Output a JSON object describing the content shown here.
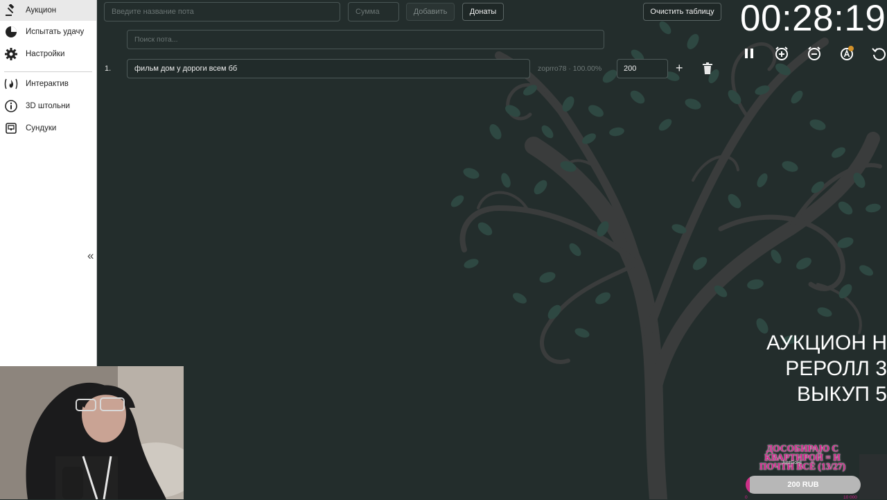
{
  "sidebar": {
    "items": [
      {
        "label": "Аукцион",
        "icon": "gavel-icon"
      },
      {
        "label": "Испытать удачу",
        "icon": "pie-chart-icon"
      },
      {
        "label": "Настройки",
        "icon": "gear-icon"
      },
      {
        "label": "Интерактив",
        "icon": "fire-icon"
      },
      {
        "label": "3D штольни",
        "icon": "info-icon"
      },
      {
        "label": "Сундуки",
        "icon": "chest-icon"
      }
    ],
    "collapse_label": "«"
  },
  "toolbar": {
    "name_placeholder": "Введите название пота",
    "amount_placeholder": "Сумма",
    "add_label": "Добавить",
    "donations_label": "Донаты",
    "clear_label": "Очистить таблицу"
  },
  "search": {
    "placeholder": "Поиск пота..."
  },
  "lots": [
    {
      "number": "1.",
      "name": "фильм дом у дороги всем бб",
      "meta": "zoprro78 · 100.00%",
      "amount": "200"
    }
  ],
  "timer": {
    "display": "00:28:19"
  },
  "overlay": {
    "line1": "АУКЦИОН Н",
    "line2": "РЕРОЛЛ 3",
    "line3": "ВЫКУП 5"
  },
  "goal_widget": {
    "title": "ДОСОБИРАЮ С КВАРТИРОЙ = И ПОЧТИ ВСЁ (13/27)",
    "user": "JustGoHi",
    "amount": "200 RUB",
    "min": "0",
    "max": "10 000",
    "progress_fraction": 0.02
  },
  "colors": {
    "background": "#232d2c",
    "tree_trunk": "#3b3d3d",
    "leaves": "#2f4a44",
    "accent_pink": "#d21e8a"
  }
}
